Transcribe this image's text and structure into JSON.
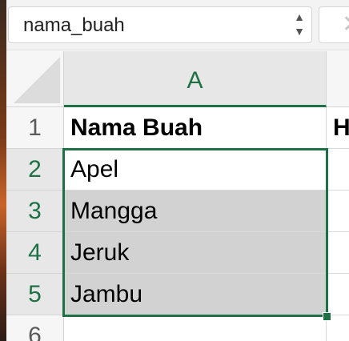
{
  "name_box": {
    "value": "nama_buah"
  },
  "columns": {
    "a": "A",
    "b": ""
  },
  "rows": [
    {
      "number": "1",
      "a": "Nama Buah",
      "b": "H"
    },
    {
      "number": "2",
      "a": "Apel",
      "b": ""
    },
    {
      "number": "3",
      "a": "Mangga",
      "b": ""
    },
    {
      "number": "4",
      "a": "Jeruk",
      "b": ""
    },
    {
      "number": "5",
      "a": "Jambu",
      "b": ""
    },
    {
      "number": "6",
      "a": "",
      "b": ""
    }
  ],
  "colors": {
    "accent": "#1e7145",
    "selection_fill": "#d2d2d2"
  }
}
